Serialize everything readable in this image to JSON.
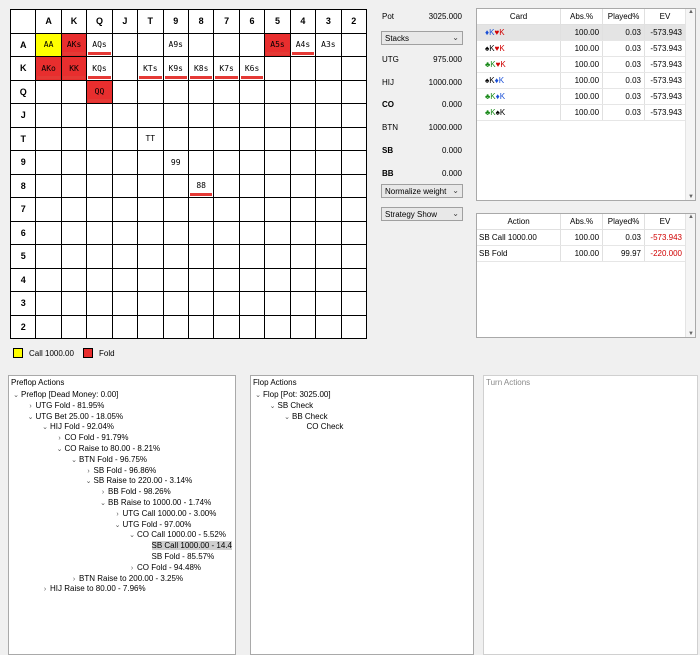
{
  "grid": {
    "col_headers": [
      "A",
      "K",
      "Q",
      "J",
      "T",
      "9",
      "8",
      "7",
      "6",
      "5",
      "4",
      "3",
      "2"
    ],
    "row_headers": [
      "A",
      "K",
      "Q",
      "J",
      "T",
      "9",
      "8",
      "7",
      "6",
      "5",
      "4",
      "3",
      "2"
    ],
    "rows": [
      [
        {
          "t": "AA",
          "s": "call"
        },
        {
          "t": "AKs",
          "s": "fold"
        },
        {
          "t": "AQs",
          "s": "bar"
        },
        {
          "t": ""
        },
        {
          "t": ""
        },
        {
          "t": "A9s"
        },
        {
          "t": ""
        },
        {
          "t": ""
        },
        {
          "t": ""
        },
        {
          "t": "A5s",
          "s": "fold"
        },
        {
          "t": "A4s",
          "s": "bar"
        },
        {
          "t": "A3s"
        },
        {
          "t": ""
        }
      ],
      [
        {
          "t": "AKo",
          "s": "fold"
        },
        {
          "t": "KK",
          "s": "fold"
        },
        {
          "t": "KQs",
          "s": "bar"
        },
        {
          "t": ""
        },
        {
          "t": "KTs",
          "s": "bar"
        },
        {
          "t": "K9s",
          "s": "bar"
        },
        {
          "t": "K8s",
          "s": "bar"
        },
        {
          "t": "K7s",
          "s": "bar"
        },
        {
          "t": "K6s",
          "s": "bar"
        },
        {
          "t": ""
        },
        {
          "t": ""
        },
        {
          "t": ""
        },
        {
          "t": ""
        }
      ],
      [
        {
          "t": ""
        },
        {
          "t": ""
        },
        {
          "t": "QQ",
          "s": "fold"
        },
        {
          "t": ""
        },
        {
          "t": ""
        },
        {
          "t": ""
        },
        {
          "t": ""
        },
        {
          "t": ""
        },
        {
          "t": ""
        },
        {
          "t": ""
        },
        {
          "t": ""
        },
        {
          "t": ""
        },
        {
          "t": ""
        }
      ],
      [
        {
          "t": ""
        },
        {
          "t": ""
        },
        {
          "t": ""
        },
        {
          "t": ""
        },
        {
          "t": ""
        },
        {
          "t": ""
        },
        {
          "t": ""
        },
        {
          "t": ""
        },
        {
          "t": ""
        },
        {
          "t": ""
        },
        {
          "t": ""
        },
        {
          "t": ""
        },
        {
          "t": ""
        }
      ],
      [
        {
          "t": ""
        },
        {
          "t": ""
        },
        {
          "t": ""
        },
        {
          "t": ""
        },
        {
          "t": "TT"
        },
        {
          "t": ""
        },
        {
          "t": ""
        },
        {
          "t": ""
        },
        {
          "t": ""
        },
        {
          "t": ""
        },
        {
          "t": ""
        },
        {
          "t": ""
        },
        {
          "t": ""
        }
      ],
      [
        {
          "t": ""
        },
        {
          "t": ""
        },
        {
          "t": ""
        },
        {
          "t": ""
        },
        {
          "t": ""
        },
        {
          "t": "99"
        },
        {
          "t": ""
        },
        {
          "t": ""
        },
        {
          "t": ""
        },
        {
          "t": ""
        },
        {
          "t": ""
        },
        {
          "t": ""
        },
        {
          "t": ""
        }
      ],
      [
        {
          "t": ""
        },
        {
          "t": ""
        },
        {
          "t": ""
        },
        {
          "t": ""
        },
        {
          "t": ""
        },
        {
          "t": ""
        },
        {
          "t": "88",
          "s": "bar"
        },
        {
          "t": ""
        },
        {
          "t": ""
        },
        {
          "t": ""
        },
        {
          "t": ""
        },
        {
          "t": ""
        },
        {
          "t": ""
        }
      ],
      [
        {
          "t": ""
        },
        {
          "t": ""
        },
        {
          "t": ""
        },
        {
          "t": ""
        },
        {
          "t": ""
        },
        {
          "t": ""
        },
        {
          "t": ""
        },
        {
          "t": ""
        },
        {
          "t": ""
        },
        {
          "t": ""
        },
        {
          "t": ""
        },
        {
          "t": ""
        },
        {
          "t": ""
        }
      ],
      [
        {
          "t": ""
        },
        {
          "t": ""
        },
        {
          "t": ""
        },
        {
          "t": ""
        },
        {
          "t": ""
        },
        {
          "t": ""
        },
        {
          "t": ""
        },
        {
          "t": ""
        },
        {
          "t": ""
        },
        {
          "t": ""
        },
        {
          "t": ""
        },
        {
          "t": ""
        },
        {
          "t": ""
        }
      ],
      [
        {
          "t": ""
        },
        {
          "t": ""
        },
        {
          "t": ""
        },
        {
          "t": ""
        },
        {
          "t": ""
        },
        {
          "t": ""
        },
        {
          "t": ""
        },
        {
          "t": ""
        },
        {
          "t": ""
        },
        {
          "t": ""
        },
        {
          "t": ""
        },
        {
          "t": ""
        },
        {
          "t": ""
        }
      ],
      [
        {
          "t": ""
        },
        {
          "t": ""
        },
        {
          "t": ""
        },
        {
          "t": ""
        },
        {
          "t": ""
        },
        {
          "t": ""
        },
        {
          "t": ""
        },
        {
          "t": ""
        },
        {
          "t": ""
        },
        {
          "t": ""
        },
        {
          "t": ""
        },
        {
          "t": ""
        },
        {
          "t": ""
        }
      ],
      [
        {
          "t": ""
        },
        {
          "t": ""
        },
        {
          "t": ""
        },
        {
          "t": ""
        },
        {
          "t": ""
        },
        {
          "t": ""
        },
        {
          "t": ""
        },
        {
          "t": ""
        },
        {
          "t": ""
        },
        {
          "t": ""
        },
        {
          "t": ""
        },
        {
          "t": ""
        },
        {
          "t": ""
        }
      ],
      [
        {
          "t": ""
        },
        {
          "t": ""
        },
        {
          "t": ""
        },
        {
          "t": ""
        },
        {
          "t": ""
        },
        {
          "t": ""
        },
        {
          "t": ""
        },
        {
          "t": ""
        },
        {
          "t": ""
        },
        {
          "t": ""
        },
        {
          "t": ""
        },
        {
          "t": ""
        },
        {
          "t": ""
        }
      ]
    ]
  },
  "legend": {
    "call": "Call 1000.00",
    "fold": "Fold",
    "call_color": "#ffff00",
    "fold_color": "#e82e2e"
  },
  "info": {
    "pot_label": "Pot",
    "pot_value": "3025.000",
    "stacks_select": "Stacks",
    "players": [
      {
        "name": "UTG",
        "value": "975.000",
        "bold": false
      },
      {
        "name": "HIJ",
        "value": "1000.000",
        "bold": false
      },
      {
        "name": "CO",
        "value": "0.000",
        "bold": true
      },
      {
        "name": "BTN",
        "value": "1000.000",
        "bold": false
      },
      {
        "name": "SB",
        "value": "0.000",
        "bold": true
      },
      {
        "name": "BB",
        "value": "0.000",
        "bold": true
      }
    ],
    "normalize_select": "Normalize weight",
    "strategy_select": "Strategy Show"
  },
  "cards_table": {
    "headers": [
      "Card",
      "Abs.%",
      "Played%",
      "EV"
    ],
    "rows": [
      {
        "c1": "K",
        "s1": "♦",
        "col1": "#1a4fd6",
        "c2": "K",
        "s2": "♥",
        "col2": "#d00000",
        "abs": "100.00",
        "played": "0.03",
        "ev": "-573.943"
      },
      {
        "c1": "K",
        "s1": "♠",
        "col1": "#000000",
        "c2": "K",
        "s2": "♥",
        "col2": "#d00000",
        "abs": "100.00",
        "played": "0.03",
        "ev": "-573.943"
      },
      {
        "c1": "K",
        "s1": "♣",
        "col1": "#1a8a1a",
        "c2": "K",
        "s2": "♥",
        "col2": "#d00000",
        "abs": "100.00",
        "played": "0.03",
        "ev": "-573.943"
      },
      {
        "c1": "K",
        "s1": "♠",
        "col1": "#000000",
        "c2": "K",
        "s2": "♦",
        "col2": "#1a4fd6",
        "abs": "100.00",
        "played": "0.03",
        "ev": "-573.943"
      },
      {
        "c1": "K",
        "s1": "♣",
        "col1": "#1a8a1a",
        "c2": "K",
        "s2": "♦",
        "col2": "#1a4fd6",
        "abs": "100.00",
        "played": "0.03",
        "ev": "-573.943"
      },
      {
        "c1": "K",
        "s1": "♣",
        "col1": "#1a8a1a",
        "c2": "K",
        "s2": "♠",
        "col2": "#000000",
        "abs": "100.00",
        "played": "0.03",
        "ev": "-573.943"
      }
    ]
  },
  "actions_table": {
    "headers": [
      "Action",
      "Abs.%",
      "Played%",
      "EV"
    ],
    "rows": [
      {
        "action": "SB Call 1000.00",
        "abs": "100.00",
        "played": "0.03",
        "ev": "-573.943"
      },
      {
        "action": "SB Fold",
        "abs": "100.00",
        "played": "99.97",
        "ev": "-220.000"
      }
    ]
  },
  "preflop": {
    "title": "Preflop Actions",
    "nodes": [
      {
        "d": 0,
        "e": "v",
        "label": "Preflop [Dead Money: 0.00]"
      },
      {
        "d": 1,
        "e": ">",
        "label": "UTG Fold - 81.95%"
      },
      {
        "d": 1,
        "e": "v",
        "label": "UTG Bet 25.00 - 18.05%"
      },
      {
        "d": 2,
        "e": "v",
        "label": "HIJ Fold - 92.04%"
      },
      {
        "d": 3,
        "e": ">",
        "label": "CO Fold - 91.79%"
      },
      {
        "d": 3,
        "e": "v",
        "label": "CO Raise to 80.00 - 8.21%"
      },
      {
        "d": 4,
        "e": "v",
        "label": "BTN Fold - 96.75%"
      },
      {
        "d": 5,
        "e": ">",
        "label": "SB Fold - 96.86%"
      },
      {
        "d": 5,
        "e": "v",
        "label": "SB Raise to 220.00 - 3.14%"
      },
      {
        "d": 6,
        "e": ">",
        "label": "BB Fold - 98.26%"
      },
      {
        "d": 6,
        "e": "v",
        "label": "BB Raise to 1000.00 - 1.74%"
      },
      {
        "d": 7,
        "e": ">",
        "label": "UTG Call 1000.00 - 3.00%"
      },
      {
        "d": 7,
        "e": "v",
        "label": "UTG Fold - 97.00%"
      },
      {
        "d": 8,
        "e": "v",
        "label": "CO Call 1000.00 - 5.52%"
      },
      {
        "d": 9,
        "e": "",
        "label": "SB Call 1000.00 - 14.4",
        "hl": true
      },
      {
        "d": 9,
        "e": "",
        "label": "SB Fold - 85.57%"
      },
      {
        "d": 8,
        "e": ">",
        "label": "CO Fold - 94.48%"
      },
      {
        "d": 4,
        "e": ">",
        "label": "BTN Raise to 200.00 - 3.25%"
      },
      {
        "d": 2,
        "e": ">",
        "label": "HIJ Raise to 80.00 - 7.96%"
      }
    ]
  },
  "flop": {
    "title": "Flop Actions",
    "nodes": [
      {
        "d": 0,
        "e": "v",
        "label": "Flop [Pot: 3025.00]"
      },
      {
        "d": 1,
        "e": "v",
        "label": "SB Check"
      },
      {
        "d": 2,
        "e": "v",
        "label": "BB Check"
      },
      {
        "d": 3,
        "e": "",
        "label": "CO Check"
      }
    ]
  },
  "turn": {
    "title": "Turn Actions"
  }
}
